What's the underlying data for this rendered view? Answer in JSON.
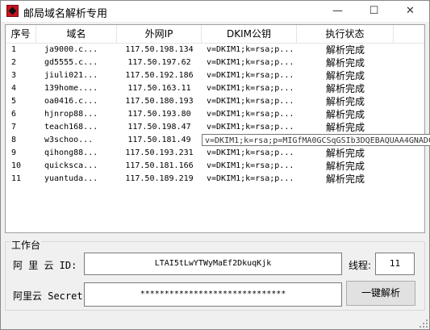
{
  "window": {
    "title": "邮局域名解析专用",
    "min_glyph": "—",
    "max_glyph": "☐",
    "close_glyph": "✕"
  },
  "table": {
    "headers": [
      "序号",
      "域名",
      "外网IP",
      "DKIM公钥",
      "执行状态"
    ],
    "rows": [
      [
        "1",
        "ja9000.c...",
        "117.50.198.134",
        "v=DKIM1;k=rsa;p...",
        "解析完成"
      ],
      [
        "2",
        "gd5555.c...",
        "117.50.197.62",
        "v=DKIM1;k=rsa;p...",
        "解析完成"
      ],
      [
        "3",
        "jiuli021...",
        "117.50.192.186",
        "v=DKIM1;k=rsa;p...",
        "解析完成"
      ],
      [
        "4",
        "139home....",
        "117.50.163.11",
        "v=DKIM1;k=rsa;p...",
        "解析完成"
      ],
      [
        "5",
        "oa0416.c...",
        "117.50.180.193",
        "v=DKIM1;k=rsa;p...",
        "解析完成"
      ],
      [
        "6",
        "hjnrop88...",
        "117.50.193.80",
        "v=DKIM1;k=rsa;p...",
        "解析完成"
      ],
      [
        "7",
        "teach168...",
        "117.50.198.47",
        "v=DKIM1;k=rsa;p...",
        "解析完成"
      ],
      [
        "8",
        "w3schoo...",
        "117.50.181.49",
        "v=DKIM1;k=rsa;p...",
        "解析完成"
      ],
      [
        "9",
        "qihong88...",
        "117.50.193.231",
        "v=DKIM1;k=rsa;p...",
        "解析完成"
      ],
      [
        "10",
        "quicksca...",
        "117.50.181.166",
        "v=DKIM1;k=rsa;p...",
        "解析完成"
      ],
      [
        "11",
        "yuantuda...",
        "117.50.189.219",
        "v=DKIM1;k=rsa;p...",
        "解析完成"
      ]
    ],
    "tooltip": "v=DKIM1;k=rsa;p=MIGfMA0GCSqGSIb3DQEBAQUAA4GNADCBiQKBgQC"
  },
  "workbench": {
    "legend": "工作台",
    "aliyun_id_label": "阿 里 云 ID:",
    "aliyun_id_value": "LTAI5tLwYTWyMaEf2DkuqKjk",
    "threads_label": "线程:",
    "threads_value": "11",
    "secret_label": "阿里云 Secret:",
    "secret_value": "******************************",
    "run_button": "一键解析"
  }
}
